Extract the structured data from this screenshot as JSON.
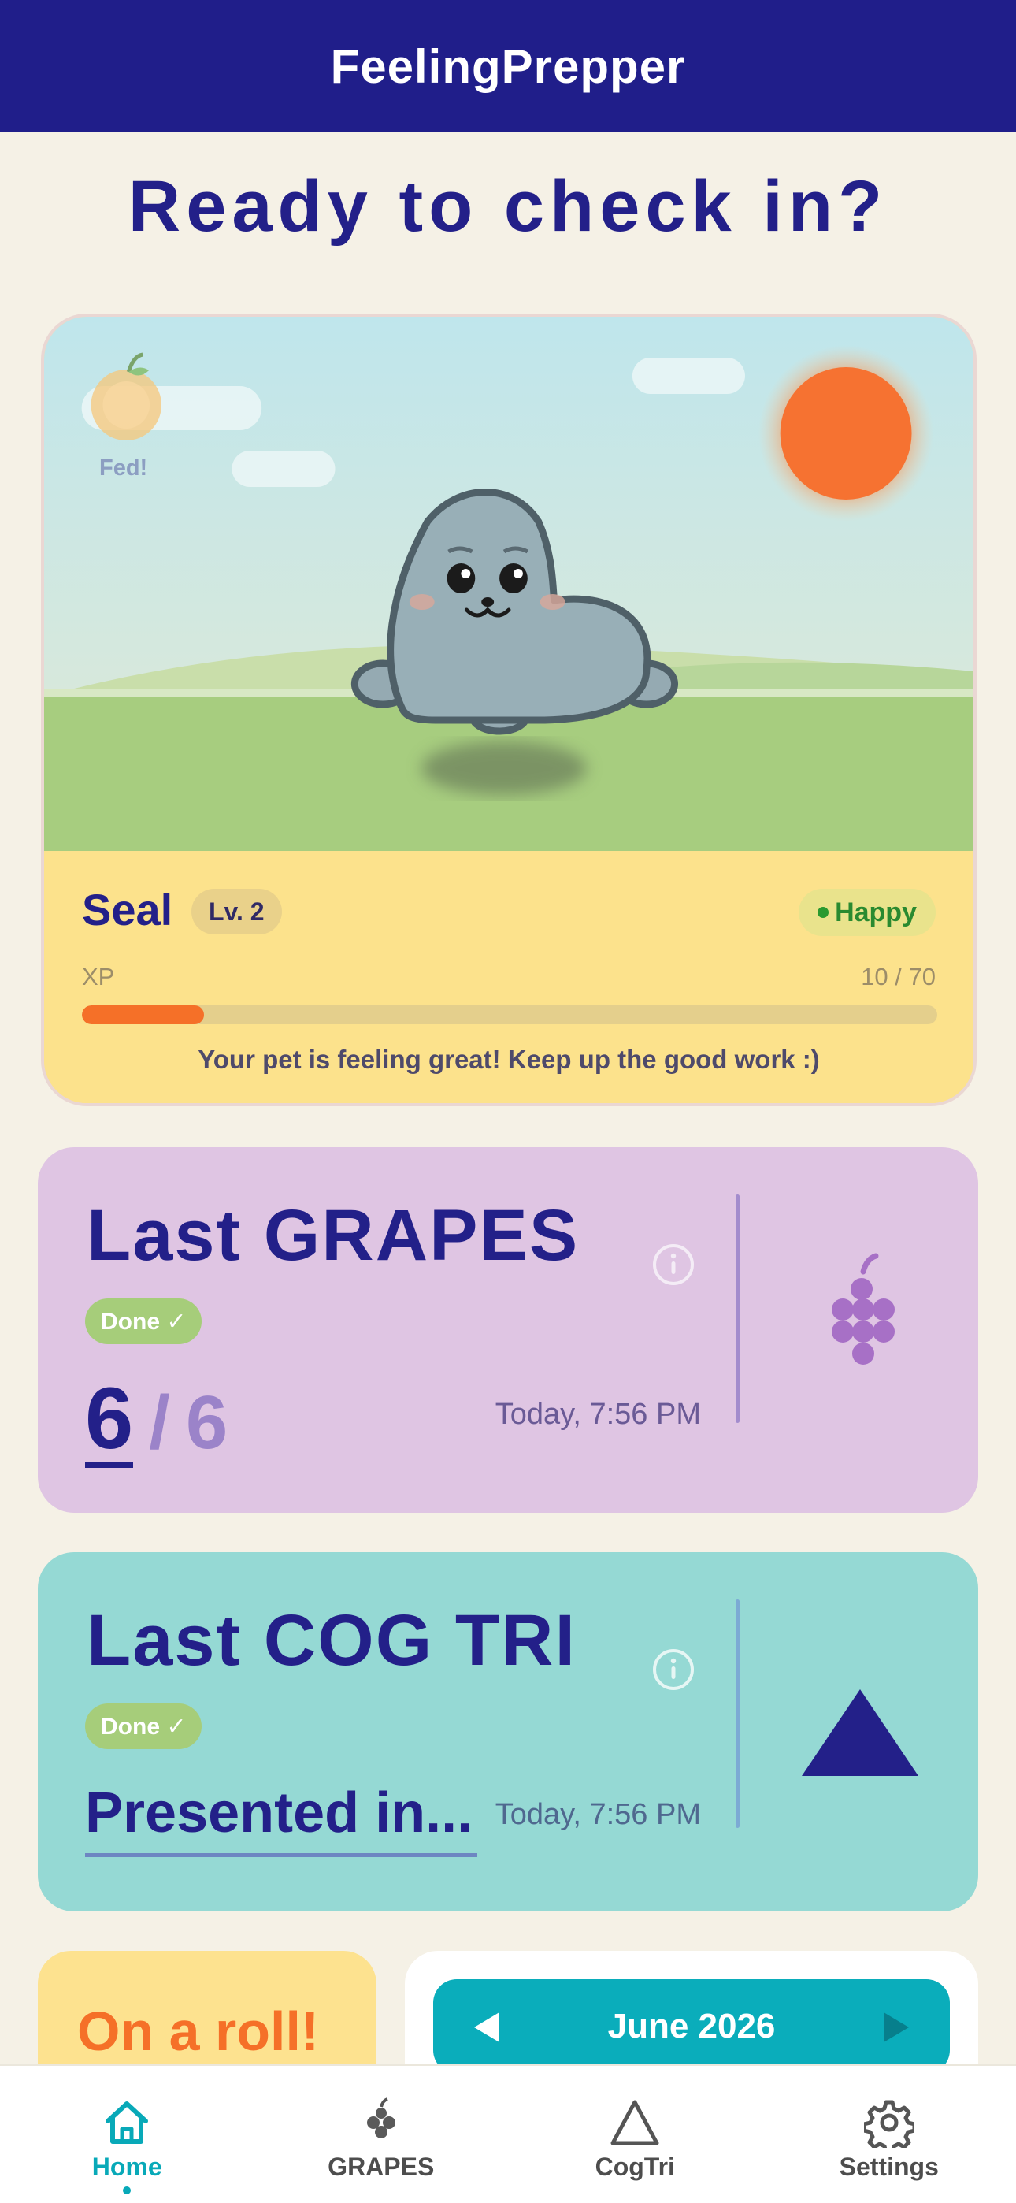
{
  "app": {
    "title": "FeelingPrepper"
  },
  "home": {
    "headline": "Ready to check in?"
  },
  "pet": {
    "fed_label": "Fed!",
    "name": "Seal",
    "level": "Lv. 2",
    "mood": "Happy",
    "xp_label": "XP",
    "xp_value": "10 / 70",
    "xp_current": 10,
    "xp_max": 70,
    "message": "Your pet is feeling great! Keep up the good work :)"
  },
  "grapes_card": {
    "title": "Last GRAPES",
    "status": "Done ✓",
    "score": "6",
    "separator": "/",
    "total": "6",
    "timestamp": "Today, 7:56 PM",
    "icon": "grapes-icon"
  },
  "cogtri_card": {
    "title": "Last COG TRI",
    "status": "Done ✓",
    "entry": "Presented in...",
    "timestamp": "Today, 7:56 PM",
    "icon": "triangle-icon"
  },
  "streak_card": {
    "text": "On a roll!"
  },
  "calendar_card": {
    "month": "June 2026"
  },
  "nav": {
    "items": [
      {
        "label": "Home",
        "icon": "home-icon",
        "active": true
      },
      {
        "label": "GRAPES",
        "icon": "grapes-icon",
        "active": false
      },
      {
        "label": "CogTri",
        "icon": "triangle-icon",
        "active": false
      },
      {
        "label": "Settings",
        "icon": "gear-icon",
        "active": false
      }
    ]
  },
  "colors": {
    "primary": "#201e8a",
    "accent_teal": "#08a9b8",
    "accent_orange": "#f57028",
    "background": "#f5f1e6",
    "grapes_card": "#dfc5e3",
    "cogtri_card": "#95d9d4",
    "pet_info": "#fce28c"
  }
}
